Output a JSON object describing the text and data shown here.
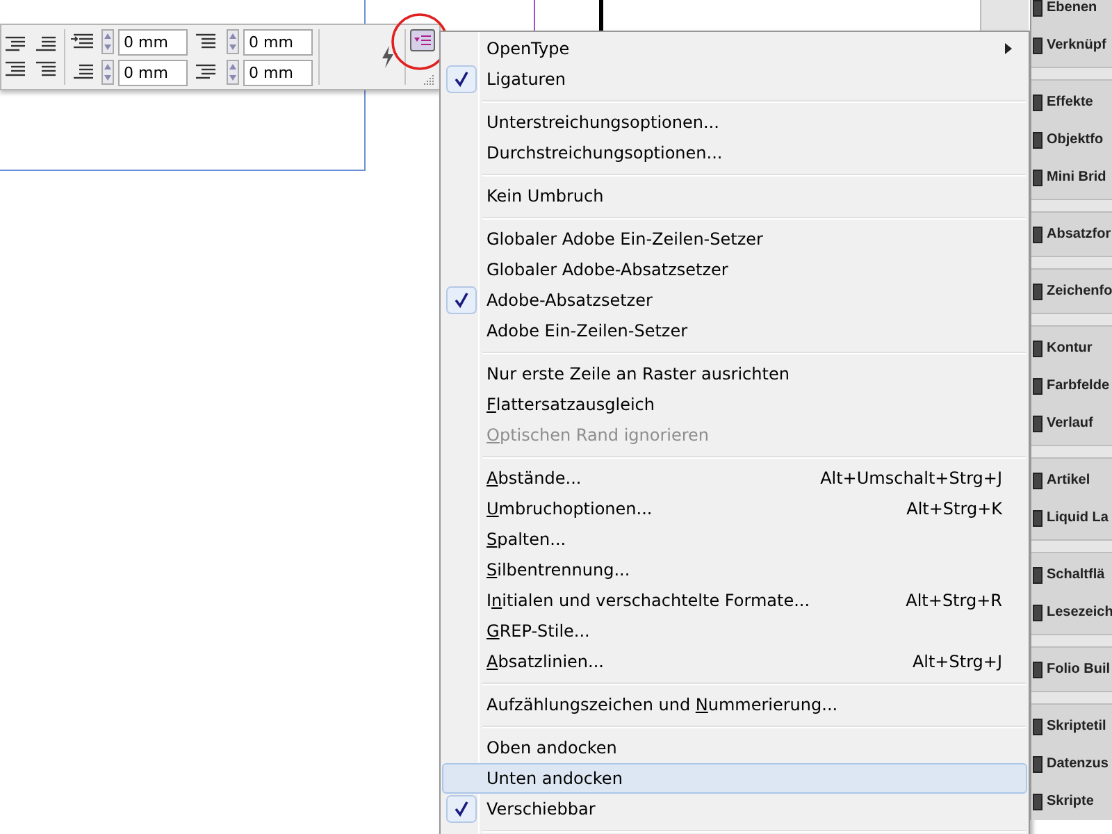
{
  "control_panel": {
    "fields": [
      {
        "value": "0 mm"
      },
      {
        "value": "0 mm"
      },
      {
        "value": "0 mm"
      },
      {
        "value": "0 mm"
      }
    ],
    "menu_button": {
      "selected": true
    }
  },
  "menu": {
    "items": [
      {
        "kind": "item",
        "label": "OpenType",
        "checked": false,
        "disabled": false,
        "selected": false,
        "submenu": true
      },
      {
        "kind": "item",
        "label": "Ligaturen",
        "checked": true,
        "disabled": false,
        "selected": false,
        "submenu": false
      },
      {
        "kind": "separator"
      },
      {
        "kind": "item",
        "label": "Unterstreichungsoptionen...",
        "checked": false,
        "disabled": false,
        "selected": false,
        "submenu": false
      },
      {
        "kind": "item",
        "label": "Durchstreichungsoptionen...",
        "checked": false,
        "disabled": false,
        "selected": false,
        "submenu": false
      },
      {
        "kind": "separator"
      },
      {
        "kind": "item",
        "label": "Kein Umbruch",
        "checked": false,
        "disabled": false,
        "selected": false,
        "submenu": false
      },
      {
        "kind": "separator"
      },
      {
        "kind": "item",
        "label": "Globaler Adobe Ein-Zeilen-Setzer",
        "checked": false,
        "disabled": false,
        "selected": false,
        "submenu": false
      },
      {
        "kind": "item",
        "label": "Globaler Adobe-Absatzsetzer",
        "checked": false,
        "disabled": false,
        "selected": false,
        "submenu": false
      },
      {
        "kind": "item",
        "label": "Adobe-Absatzsetzer",
        "checked": true,
        "disabled": false,
        "selected": false,
        "submenu": false
      },
      {
        "kind": "item",
        "label": "Adobe Ein-Zeilen-Setzer",
        "checked": false,
        "disabled": false,
        "selected": false,
        "submenu": false
      },
      {
        "kind": "separator"
      },
      {
        "kind": "item",
        "label": "Nur erste Zeile an Raster ausrichten",
        "checked": false,
        "disabled": false,
        "selected": false,
        "submenu": false
      },
      {
        "kind": "item",
        "access_key": "F",
        "label_end": "lattersatzausgleich",
        "checked": false,
        "disabled": false,
        "selected": false,
        "submenu": false
      },
      {
        "kind": "item",
        "access_key": "O",
        "label_end": "ptischen Rand ignorieren",
        "checked": false,
        "disabled": true,
        "selected": false,
        "submenu": false
      },
      {
        "kind": "separator"
      },
      {
        "kind": "item",
        "access_key": "A",
        "label_end": "bstände...",
        "shortcut": "Alt+Umschalt+Strg+J",
        "checked": false,
        "disabled": false,
        "selected": false,
        "submenu": false
      },
      {
        "kind": "item",
        "access_key": "U",
        "label_end": "mbruchoptionen...",
        "shortcut": "Alt+Strg+K",
        "checked": false,
        "disabled": false,
        "selected": false,
        "submenu": false
      },
      {
        "kind": "item",
        "access_key": "S",
        "label_end": "palten...",
        "checked": false,
        "disabled": false,
        "selected": false,
        "submenu": false
      },
      {
        "kind": "item",
        "access_key": "S",
        "label_end": "ilbentrennung...",
        "checked": false,
        "disabled": false,
        "selected": false,
        "submenu": false
      },
      {
        "kind": "item",
        "label_start": "I",
        "access_key": "n",
        "label_end": "itialen und verschachtelte Formate...",
        "shortcut": "Alt+Strg+R",
        "checked": false,
        "disabled": false,
        "selected": false,
        "submenu": false
      },
      {
        "kind": "item",
        "access_key": "G",
        "label_end": "REP-Stile...",
        "checked": false,
        "disabled": false,
        "selected": false,
        "submenu": false
      },
      {
        "kind": "item",
        "access_key": "A",
        "label_end": "bsatzlinien...",
        "shortcut": "Alt+Strg+J",
        "checked": false,
        "disabled": false,
        "selected": false,
        "submenu": false
      },
      {
        "kind": "separator"
      },
      {
        "kind": "item",
        "label_start": "Aufzählungszeichen und ",
        "access_key": "N",
        "label_end": "ummerierung...",
        "checked": false,
        "disabled": false,
        "selected": false,
        "submenu": false
      },
      {
        "kind": "separator"
      },
      {
        "kind": "item",
        "label": "Oben andocken",
        "checked": false,
        "disabled": false,
        "selected": false,
        "submenu": false
      },
      {
        "kind": "item",
        "label": "Unten andocken",
        "checked": false,
        "disabled": false,
        "selected": true,
        "submenu": false
      },
      {
        "kind": "item",
        "label": "Verschiebbar",
        "checked": true,
        "disabled": false,
        "selected": false,
        "submenu": false
      },
      {
        "kind": "separator"
      }
    ]
  },
  "panels": {
    "groups": [
      {
        "items": [
          {
            "label": "Ebenen"
          },
          {
            "label": "Verknüpf"
          }
        ]
      },
      {
        "items": [
          {
            "label": "Effekte"
          },
          {
            "label": "Objektfo"
          },
          {
            "label": "Mini Brid"
          }
        ]
      },
      {
        "items": [
          {
            "label": "Absatzfor"
          }
        ]
      },
      {
        "items": [
          {
            "label": "Zeichenfo"
          }
        ]
      },
      {
        "items": [
          {
            "label": "Kontur"
          },
          {
            "label": "Farbfelde"
          },
          {
            "label": "Verlauf"
          }
        ]
      },
      {
        "items": [
          {
            "label": "Artikel"
          },
          {
            "label": "Liquid La"
          }
        ]
      },
      {
        "items": [
          {
            "label": "Schaltflä"
          },
          {
            "label": "Lesezeich"
          }
        ]
      },
      {
        "items": [
          {
            "label": "Folio Buil"
          }
        ]
      },
      {
        "items": [
          {
            "label": "Skriptetil"
          },
          {
            "label": "Datenzus"
          },
          {
            "label": "Skripte"
          }
        ]
      }
    ]
  }
}
